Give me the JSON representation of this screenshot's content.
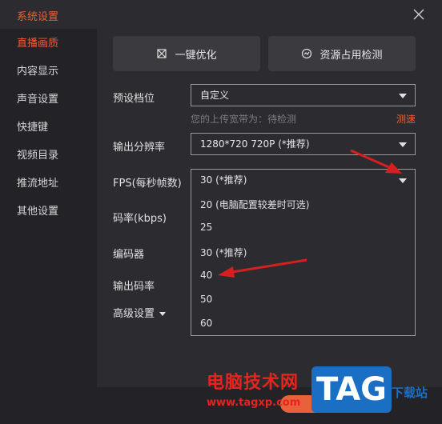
{
  "window": {
    "title": "系统设置"
  },
  "sidebar": {
    "items": [
      {
        "label": "直播画质",
        "active": true
      },
      {
        "label": "内容显示",
        "active": false
      },
      {
        "label": "声音设置",
        "active": false
      },
      {
        "label": "快捷键",
        "active": false
      },
      {
        "label": "视频目录",
        "active": false
      },
      {
        "label": "推流地址",
        "active": false
      },
      {
        "label": "其他设置",
        "active": false
      }
    ]
  },
  "toolbar": {
    "optimize_label": "一键优化",
    "resource_label": "资源占用检测"
  },
  "form": {
    "preset_label": "预设档位",
    "preset_value": "自定义",
    "upload_hint": "您的上传宽带为：待检测",
    "speedtest_label": "测速",
    "resolution_label": "输出分辨率",
    "resolution_value": "1280*720 720P (*推荐)",
    "fps_label": "FPS(每秒帧数)",
    "fps_value": "30 (*推荐)",
    "fps_options": [
      "20 (电脑配置较差时可选)",
      "25",
      "30 (*推荐)",
      "40",
      "50",
      "60"
    ],
    "bitrate_label": "码率(kbps)",
    "encoder_label": "编码器",
    "output_bitrate_label": "输出码率",
    "advanced_label": "高级设置"
  },
  "watermark": {
    "text": "电脑技术网",
    "url": "www.tagxp.com",
    "logo": "TAG",
    "site_suffix": "下载站"
  },
  "colors": {
    "accent": "#e8613a",
    "background": "#2c2c30",
    "sidebar": "#232327",
    "annotation_arrow": "#d61f1f"
  }
}
